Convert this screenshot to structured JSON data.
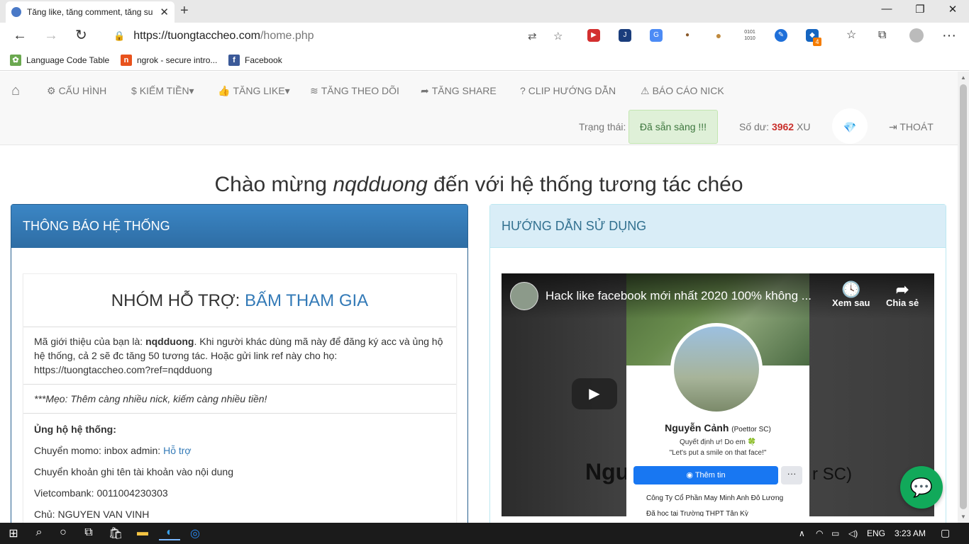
{
  "browser": {
    "tab_title": "Tăng like, tăng comment, tăng su",
    "tab_close": "✕",
    "new_tab": "+",
    "url_host": "https://tuongtaccheo.com",
    "url_path": "/home.php",
    "window_minimize": "—",
    "window_maximize": "❐",
    "window_close": "✕",
    "ext_badge": "4"
  },
  "bookmarks": [
    {
      "label": "Language Code Table",
      "color": "#6aa84f"
    },
    {
      "label": "ngrok - secure intro...",
      "color": "#e8521c"
    },
    {
      "label": "Facebook",
      "color": "#3b5998"
    }
  ],
  "nav": {
    "items": [
      {
        "label": "CẤU HÌNH"
      },
      {
        "label": "KIẾM TIỀN▾"
      },
      {
        "label": "TĂNG LIKE▾"
      },
      {
        "label": "TĂNG THEO DÕI"
      },
      {
        "label": "TĂNG SHARE"
      },
      {
        "label": "CLIP HƯỚNG DẪN"
      },
      {
        "label": "BÁO CÁO NICK"
      }
    ],
    "status_label": "Trạng thái:",
    "status_value": "Đã sẵn sàng !!!",
    "balance_label": "Số dư:",
    "balance_value": "3962",
    "balance_unit": "XU",
    "logout": "THOÁT"
  },
  "welcome": {
    "prefix": "Chào mừng",
    "username": "nqdduong",
    "suffix": "đến với hệ thống tương tác chéo"
  },
  "notice_panel": {
    "title": "THÔNG BÁO HỆ THỐNG",
    "group_label": "NHÓM HỖ TRỢ:",
    "group_link": "BẤM THAM GIA",
    "referral_prefix": "Mã giới thiệu của bạn là:",
    "referral_code": "nqdduong",
    "referral_text": ". Khi người khác dùng mã này để đăng ký acc và ủng hộ hệ thống, cả 2 sẽ đc tăng 50 tương tác. Hoặc gửi link ref này cho họ: https://tuongtaccheo.com?ref=nqdduong",
    "tip": "***Mẹo: Thêm càng nhiều nick, kiếm càng nhiều tiền!",
    "support_title": "Ủng hộ hệ thống:",
    "momo_text": "Chuyển momo: inbox admin:",
    "momo_link": "Hỗ trợ",
    "bank_note": "Chuyển khoản ghi tên tài khoản vào nội dung",
    "bank_account": "Vietcombank: 0011004230303",
    "owner": "Chủ: NGUYEN VAN VINH"
  },
  "guide_panel": {
    "title": "HƯỚNG DẪN SỬ DỤNG",
    "video_title": "Hack like facebook mới nhất 2020 100% không ...",
    "watch_later": "Xem sau",
    "share": "Chia sẻ",
    "profile_name": "Nguyễn Cảnh",
    "profile_alias": "(Poettor SC)",
    "bio_line1": "Quyết định ư! Do em 🍀",
    "bio_line2": "\"Let's put a smile on that face!\"",
    "add_story": "Thêm tin",
    "more": "···",
    "job1": "Công Ty Cổ Phần May Minh Anh Đô Lương",
    "job2": "Đã học tại Trường THPT Tân Kỳ",
    "big_name": "Ngu",
    "big_alias": "r SC)"
  },
  "taskbar": {
    "lang": "ENG",
    "time": "3:23 AM"
  }
}
